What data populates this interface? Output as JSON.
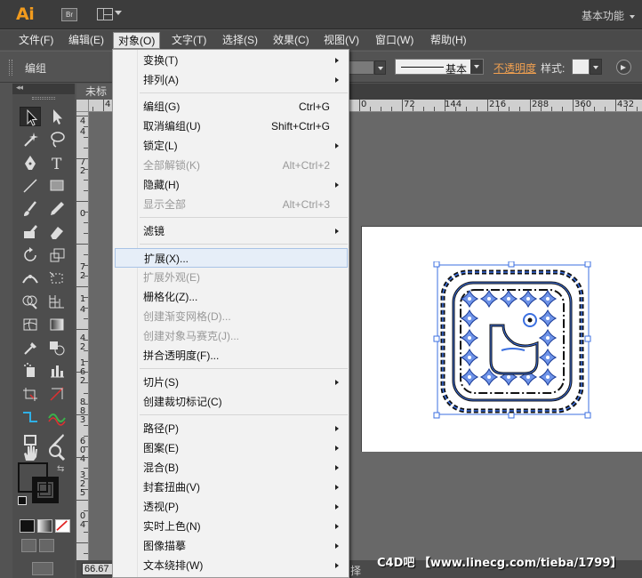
{
  "titlebar": {
    "app_logo": "Ai",
    "bridge_label": "Br",
    "workspace": "基本功能"
  },
  "menubar": {
    "items": [
      "文件(F)",
      "编辑(E)",
      "对象(O)",
      "文字(T)",
      "选择(S)",
      "效果(C)",
      "视图(V)",
      "窗口(W)",
      "帮助(H)"
    ],
    "active": "对象(O)"
  },
  "controlbar": {
    "selection_label": "编组",
    "stroke_profile": "基本",
    "opacity_label": "不透明度",
    "style_label": "样式:"
  },
  "document": {
    "tab_label": "未标",
    "zoom": "66.67",
    "status_text": "择",
    "ruler_h_labels": [
      "4",
      "0",
      "72",
      "144",
      "216",
      "288",
      "360",
      "432"
    ],
    "ruler_v_labels": [
      "4",
      "4",
      "7",
      "2",
      "0",
      "7",
      "2",
      "1",
      "4",
      "4",
      "2",
      "1",
      "6",
      "2",
      "8",
      "8",
      "3",
      "6",
      "0",
      "4",
      "3",
      "2",
      "5",
      "0",
      "4"
    ]
  },
  "object_menu": {
    "items": [
      {
        "label": "变换(T)",
        "shortcut": "",
        "submenu": true,
        "disabled": false
      },
      {
        "label": "排列(A)",
        "shortcut": "",
        "submenu": true,
        "disabled": false
      },
      {
        "label": "编组(G)",
        "shortcut": "Ctrl+G",
        "submenu": false,
        "disabled": false
      },
      {
        "label": "取消编组(U)",
        "shortcut": "Shift+Ctrl+G",
        "submenu": false,
        "disabled": false
      },
      {
        "label": "锁定(L)",
        "shortcut": "",
        "submenu": true,
        "disabled": false
      },
      {
        "label": "全部解锁(K)",
        "shortcut": "Alt+Ctrl+2",
        "submenu": false,
        "disabled": true
      },
      {
        "label": "隐藏(H)",
        "shortcut": "",
        "submenu": true,
        "disabled": false
      },
      {
        "label": "显示全部",
        "shortcut": "Alt+Ctrl+3",
        "submenu": false,
        "disabled": true
      },
      {
        "label": "滤镜",
        "shortcut": "",
        "submenu": true,
        "disabled": false
      },
      {
        "label": "扩展(X)...",
        "shortcut": "",
        "submenu": false,
        "disabled": false,
        "highlighted": true
      },
      {
        "label": "扩展外观(E)",
        "shortcut": "",
        "submenu": false,
        "disabled": true
      },
      {
        "label": "栅格化(Z)...",
        "shortcut": "",
        "submenu": false,
        "disabled": false
      },
      {
        "label": "创建渐变网格(D)...",
        "shortcut": "",
        "submenu": false,
        "disabled": true
      },
      {
        "label": "创建对象马赛克(J)...",
        "shortcut": "",
        "submenu": false,
        "disabled": true
      },
      {
        "label": "拼合透明度(F)...",
        "shortcut": "",
        "submenu": false,
        "disabled": false
      },
      {
        "label": "切片(S)",
        "shortcut": "",
        "submenu": true,
        "disabled": false
      },
      {
        "label": "创建裁切标记(C)",
        "shortcut": "",
        "submenu": false,
        "disabled": false
      },
      {
        "label": "路径(P)",
        "shortcut": "",
        "submenu": true,
        "disabled": false
      },
      {
        "label": "图案(E)",
        "shortcut": "",
        "submenu": true,
        "disabled": false
      },
      {
        "label": "混合(B)",
        "shortcut": "",
        "submenu": true,
        "disabled": false
      },
      {
        "label": "封套扭曲(V)",
        "shortcut": "",
        "submenu": true,
        "disabled": false
      },
      {
        "label": "透视(P)",
        "shortcut": "",
        "submenu": true,
        "disabled": false
      },
      {
        "label": "实时上色(N)",
        "shortcut": "",
        "submenu": true,
        "disabled": false
      },
      {
        "label": "图像描摹",
        "shortcut": "",
        "submenu": true,
        "disabled": false
      },
      {
        "label": "文本绕排(W)",
        "shortcut": "",
        "submenu": true,
        "disabled": false
      }
    ]
  },
  "watermark": "C4D吧 【www.linecg.com/tieba/1799】",
  "colors": {
    "accent": "#f29b1d",
    "selection": "#3b6fe0",
    "menu_hover": "#e6eef8"
  }
}
